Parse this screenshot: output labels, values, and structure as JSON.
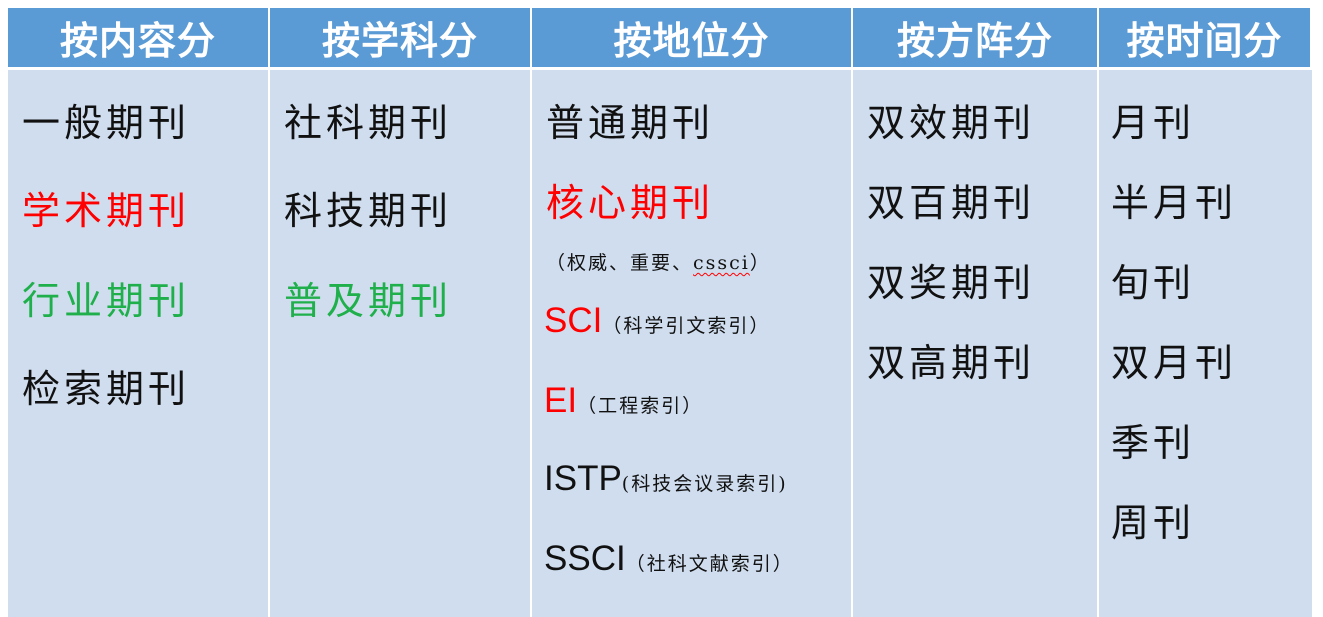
{
  "headers": [
    "按内容分",
    "按学科分",
    "按地位分",
    "按方阵分",
    "按时间分"
  ],
  "content_col": [
    "一般期刊",
    "学术期刊",
    "行业期刊",
    "检索期刊"
  ],
  "subject_col": [
    "社科期刊",
    "科技期刊",
    "普及期刊"
  ],
  "status_col": {
    "general": "普通期刊",
    "core": "核心期刊",
    "core_note_prefix": "（权威、重要、",
    "core_note_cssci": "cssci",
    "core_note_suffix": "）",
    "sci": "SCI",
    "sci_note": "（科学引文索引）",
    "ei": "EI",
    "ei_note": "（工程索引）",
    "istp": "ISTP",
    "istp_note": "(科技会议录索引)",
    "ssci": "SSCI",
    "ssci_note": "（社科文献索引）"
  },
  "matrix_col": [
    "双效期刊",
    "双百期刊",
    "双奖期刊",
    "双高期刊"
  ],
  "time_col": [
    "月刊",
    "半月刊",
    "旬刊",
    "双月刊",
    "季刊",
    "周刊"
  ],
  "colors": {
    "header_bg": "#5b9bd5",
    "body_bg": "#cfddee",
    "red": "#ff0000",
    "green": "#1faf4b"
  }
}
